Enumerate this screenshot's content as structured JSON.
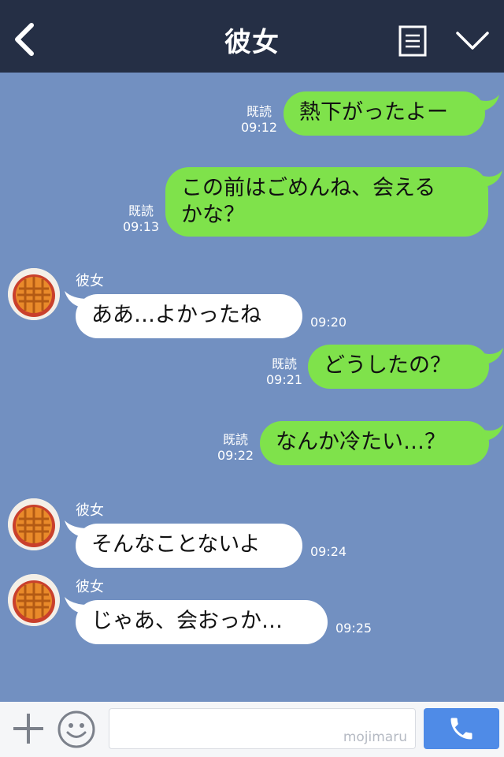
{
  "header": {
    "title": "彼女"
  },
  "colors": {
    "header_bg": "#252f45",
    "chat_bg": "#7290c1",
    "my_bubble": "#7fe24b",
    "their_bubble": "#ffffff",
    "send_button": "#4f8be7"
  },
  "messages": [
    {
      "from": "me",
      "text": "熱下がったよー",
      "read": "既読",
      "time": "09:12"
    },
    {
      "from": "me",
      "text_line1": "この前はごめんね、会える",
      "text_line2": "かな？",
      "read": "既読",
      "time": "09:13"
    },
    {
      "from": "them",
      "sender": "彼女",
      "text": "ああ…よかったね",
      "time": "09:20"
    },
    {
      "from": "me",
      "text": "どうしたの？",
      "read": "既読",
      "time": "09:21"
    },
    {
      "from": "me",
      "text": "なんか冷たい…？",
      "read": "既読",
      "time": "09:22"
    },
    {
      "from": "them",
      "sender": "彼女",
      "text": "そんなことないよ",
      "time": "09:24"
    },
    {
      "from": "them",
      "sender": "彼女",
      "text": "じゃあ、会おっか…",
      "time": "09:25"
    }
  ],
  "footer": {
    "input_value": "",
    "watermark": "mojimaru"
  },
  "icons": {
    "back": "chevron-left-icon",
    "menu": "notes-icon",
    "collapse": "chevron-down-icon",
    "plus": "plus-icon",
    "emoji": "smile-icon",
    "call": "phone-icon"
  }
}
